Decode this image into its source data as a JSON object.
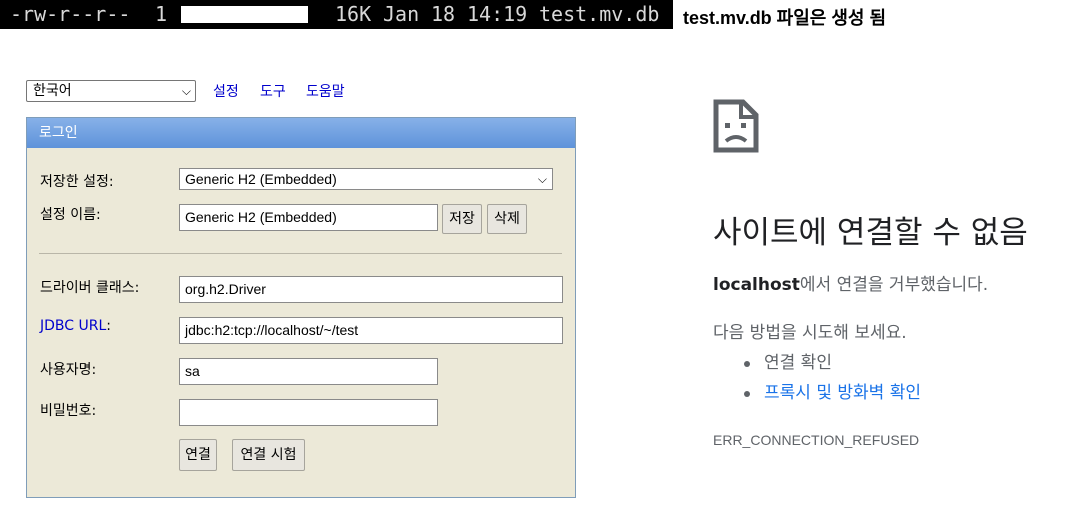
{
  "terminal": {
    "perms": "-rw-r--r--",
    "links": "1",
    "size": "16K",
    "month": "Jan",
    "day": "18",
    "time": "14:19",
    "filename": "test.mv.db"
  },
  "caption": "test.mv.db 파일은 생성 됨",
  "h2_console": {
    "language": "한국어",
    "top_links": [
      "설정",
      "도구",
      "도움말"
    ],
    "panel_title": "로그인",
    "saved_settings": {
      "label": "저장한 설정:",
      "value": "Generic H2 (Embedded)"
    },
    "setting_name": {
      "label": "설정 이름:",
      "value": "Generic H2 (Embedded)",
      "save": "저장",
      "delete": "삭제"
    },
    "driver_class": {
      "label": "드라이버 클래스:",
      "value": "org.h2.Driver"
    },
    "jdbc_url": {
      "label": "JDBC URL",
      "suffix": ":",
      "value": "jdbc:h2:tcp://localhost/~/test"
    },
    "username": {
      "label": "사용자명:",
      "value": "sa"
    },
    "password": {
      "label": "비밀번호:",
      "value": ""
    },
    "connect_button": "연결",
    "test_connection_button": "연결 시험"
  },
  "error_page": {
    "title": "사이트에 연결할 수 없음",
    "host": "localhost",
    "host_suffix": "에서 연결을 거부했습니다.",
    "try_text": "다음 방법을 시도해 보세요.",
    "suggestions": [
      "연결 확인",
      "프록시 및 방화벽 확인"
    ],
    "error_code": "ERR_CONNECTION_REFUSED"
  },
  "colors": {
    "panel_bg": "#ece9d8",
    "panel_header": "#5e93da",
    "link_blue": "#0000cc",
    "chrome_link": "#1a73e8"
  }
}
